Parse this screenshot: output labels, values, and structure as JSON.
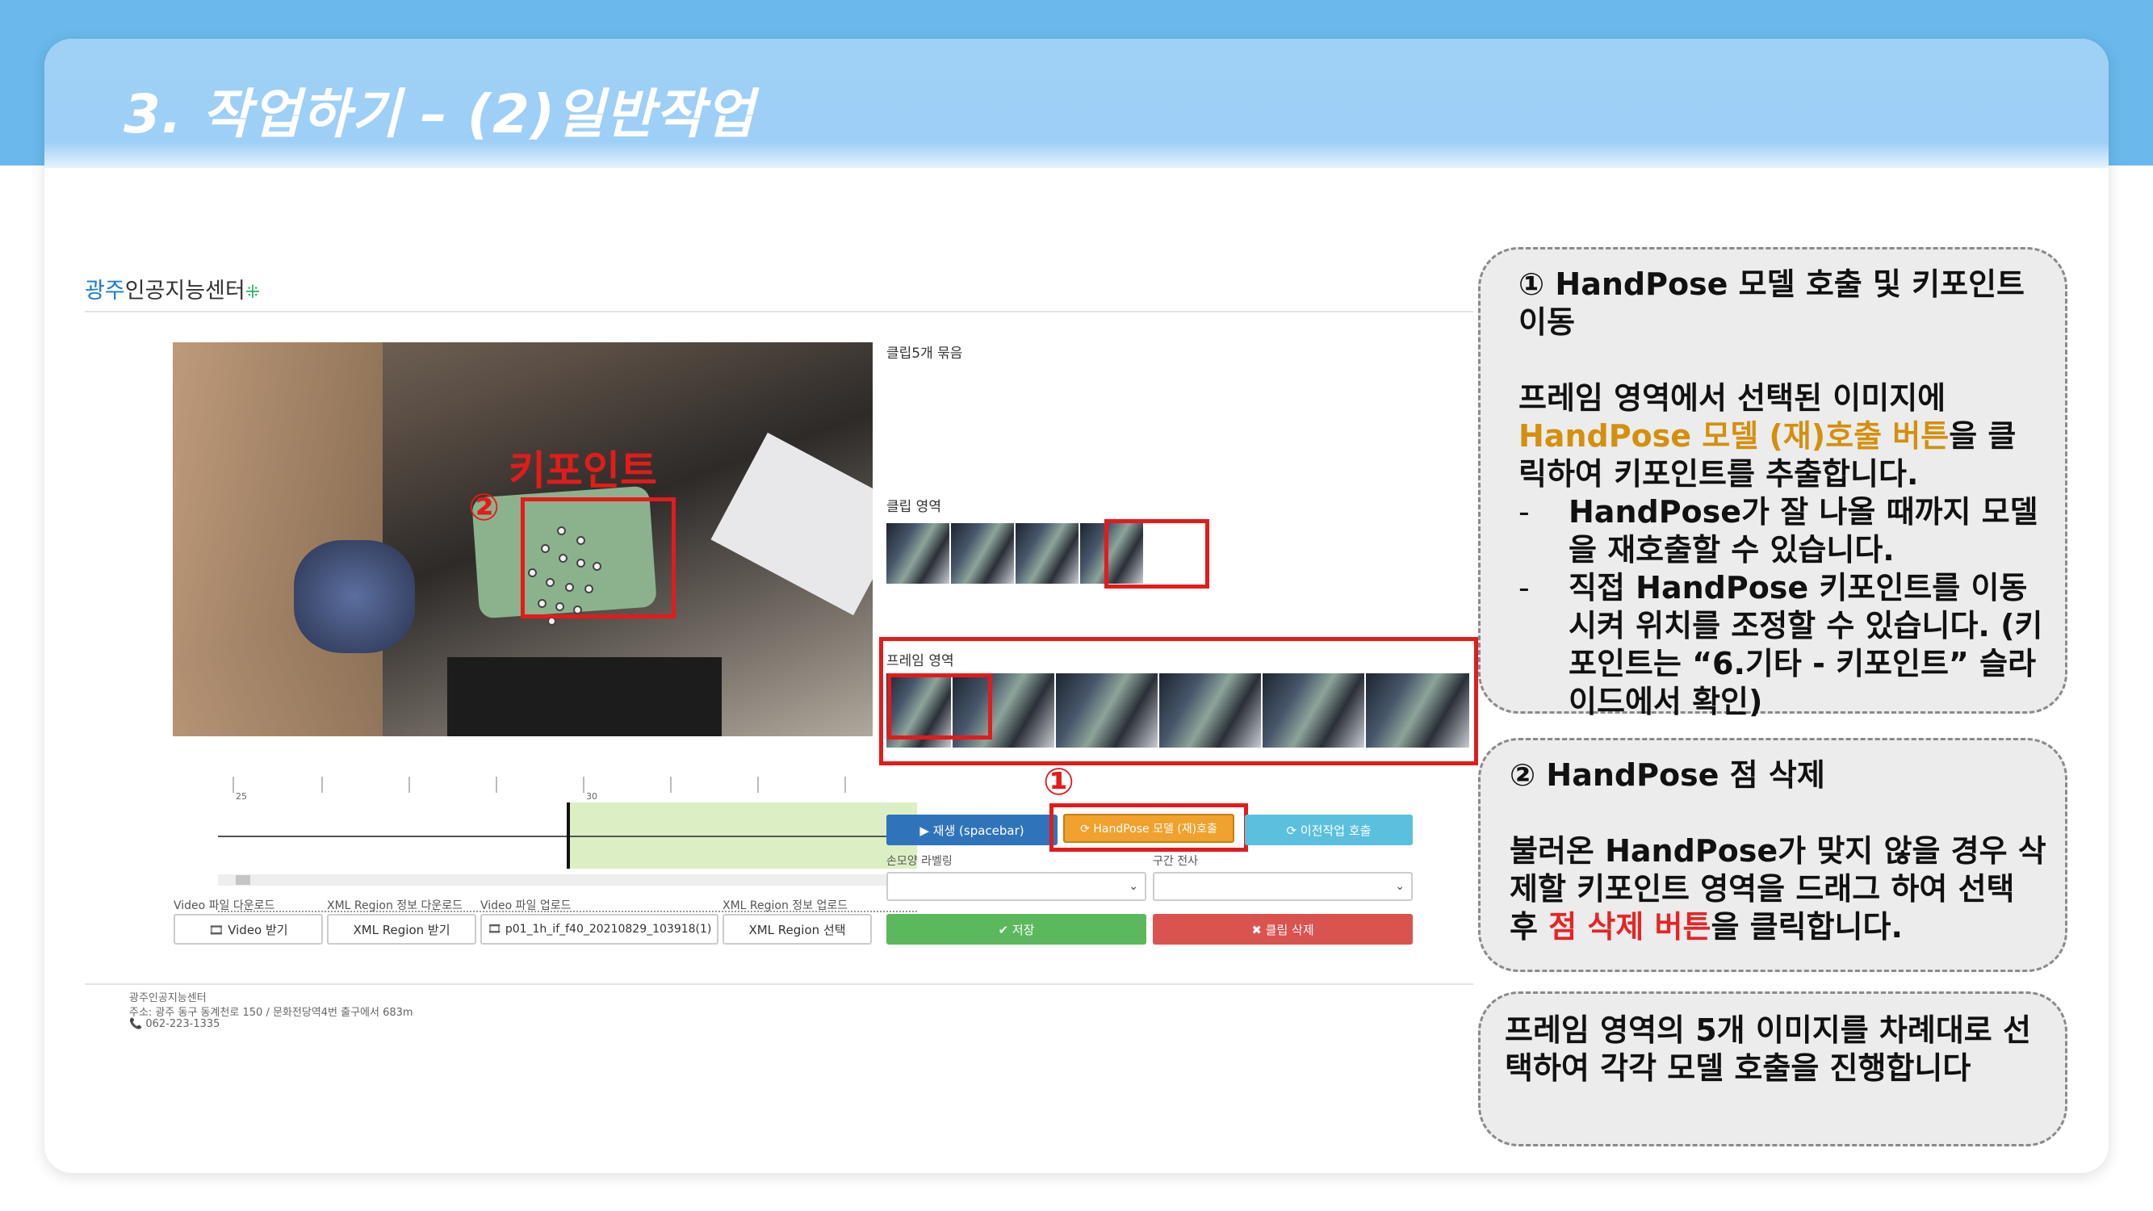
{
  "slide": {
    "title": "3. 작업하기 – (2)일반작업"
  },
  "app": {
    "logo": {
      "accent": "광주",
      "rest": "인공지능센터"
    },
    "labels": {
      "clip_bundle": "클립5개 묶음",
      "clip_area": "클립 영역",
      "frame_area": "프레임 영역",
      "hand_shape": "손모양 라벨링",
      "section_transcribe": "구간 전사"
    },
    "timeline": {
      "tick_a": "25",
      "tick_b": "30"
    },
    "buttons": {
      "play": "▶ 재생 (spacebar)",
      "handpose": "⟳ HandPose 모델 (재)호출",
      "prev_job": "⟳ 이전작업 호출",
      "save": "✔ 저장",
      "delete_clip": "✖ 클립 삭제",
      "video_download": "🎞 Video 받기",
      "xml_download": "XML Region 받기",
      "video_upload": "🎞 p01_1h_if_f40_20210829_103918(1)",
      "xml_upload": "XML Region 선택"
    },
    "file_labels": {
      "video_download": "Video 파일 다운로드",
      "xml_download": "XML Region 정보 다운로드",
      "video_upload": "Video 파일 업로드",
      "xml_upload": "XML Region 정보 업로드"
    },
    "footer": {
      "name": "광주인공지능센터",
      "address": "주소: 광주 동구 동계천로 150 / 문화전당역4번 출구에서 683m",
      "phone": "📞 062-223-1335"
    }
  },
  "annotations": {
    "keypoint_label": "키포인트",
    "marker1": "①",
    "marker2": "②"
  },
  "panels": {
    "p1": {
      "title": "① HandPose 모델 호출 및 키포인트 이동",
      "line_a": "프레임 영역에서 선택된 이미지에",
      "highlight": "HandPose 모델 (재)호출 버튼",
      "line_b": "을 클릭하여 키포인트를 추출합니다.",
      "bullet1": "HandPose가 잘 나올 때까지 모델을 재호출할 수 있습니다.",
      "bullet2": "직접 HandPose 키포인트를 이동시켜 위치를 조정할 수 있습니다. (키포인트는 “6.기타 - 키포인트” 슬라이드에서 확인)",
      "dash": "-"
    },
    "p2": {
      "title": "② HandPose 점 삭제",
      "line_a": "불러온 HandPose가 맞지 않을 경우 삭제할 키포인트 영역을 드래그 하여 선택 후",
      "highlight": "점 삭제 버튼",
      "line_b": "을 클릭합니다."
    },
    "p3": {
      "text": "프레임 영역의 5개 이미지를 차례대로 선택하여 각각 모델 호출을 진행합니다"
    }
  },
  "colors": {
    "annotation_red": "#e31b1b",
    "highlight_orange": "#d3900d",
    "header_blue": "#9ecff6"
  }
}
